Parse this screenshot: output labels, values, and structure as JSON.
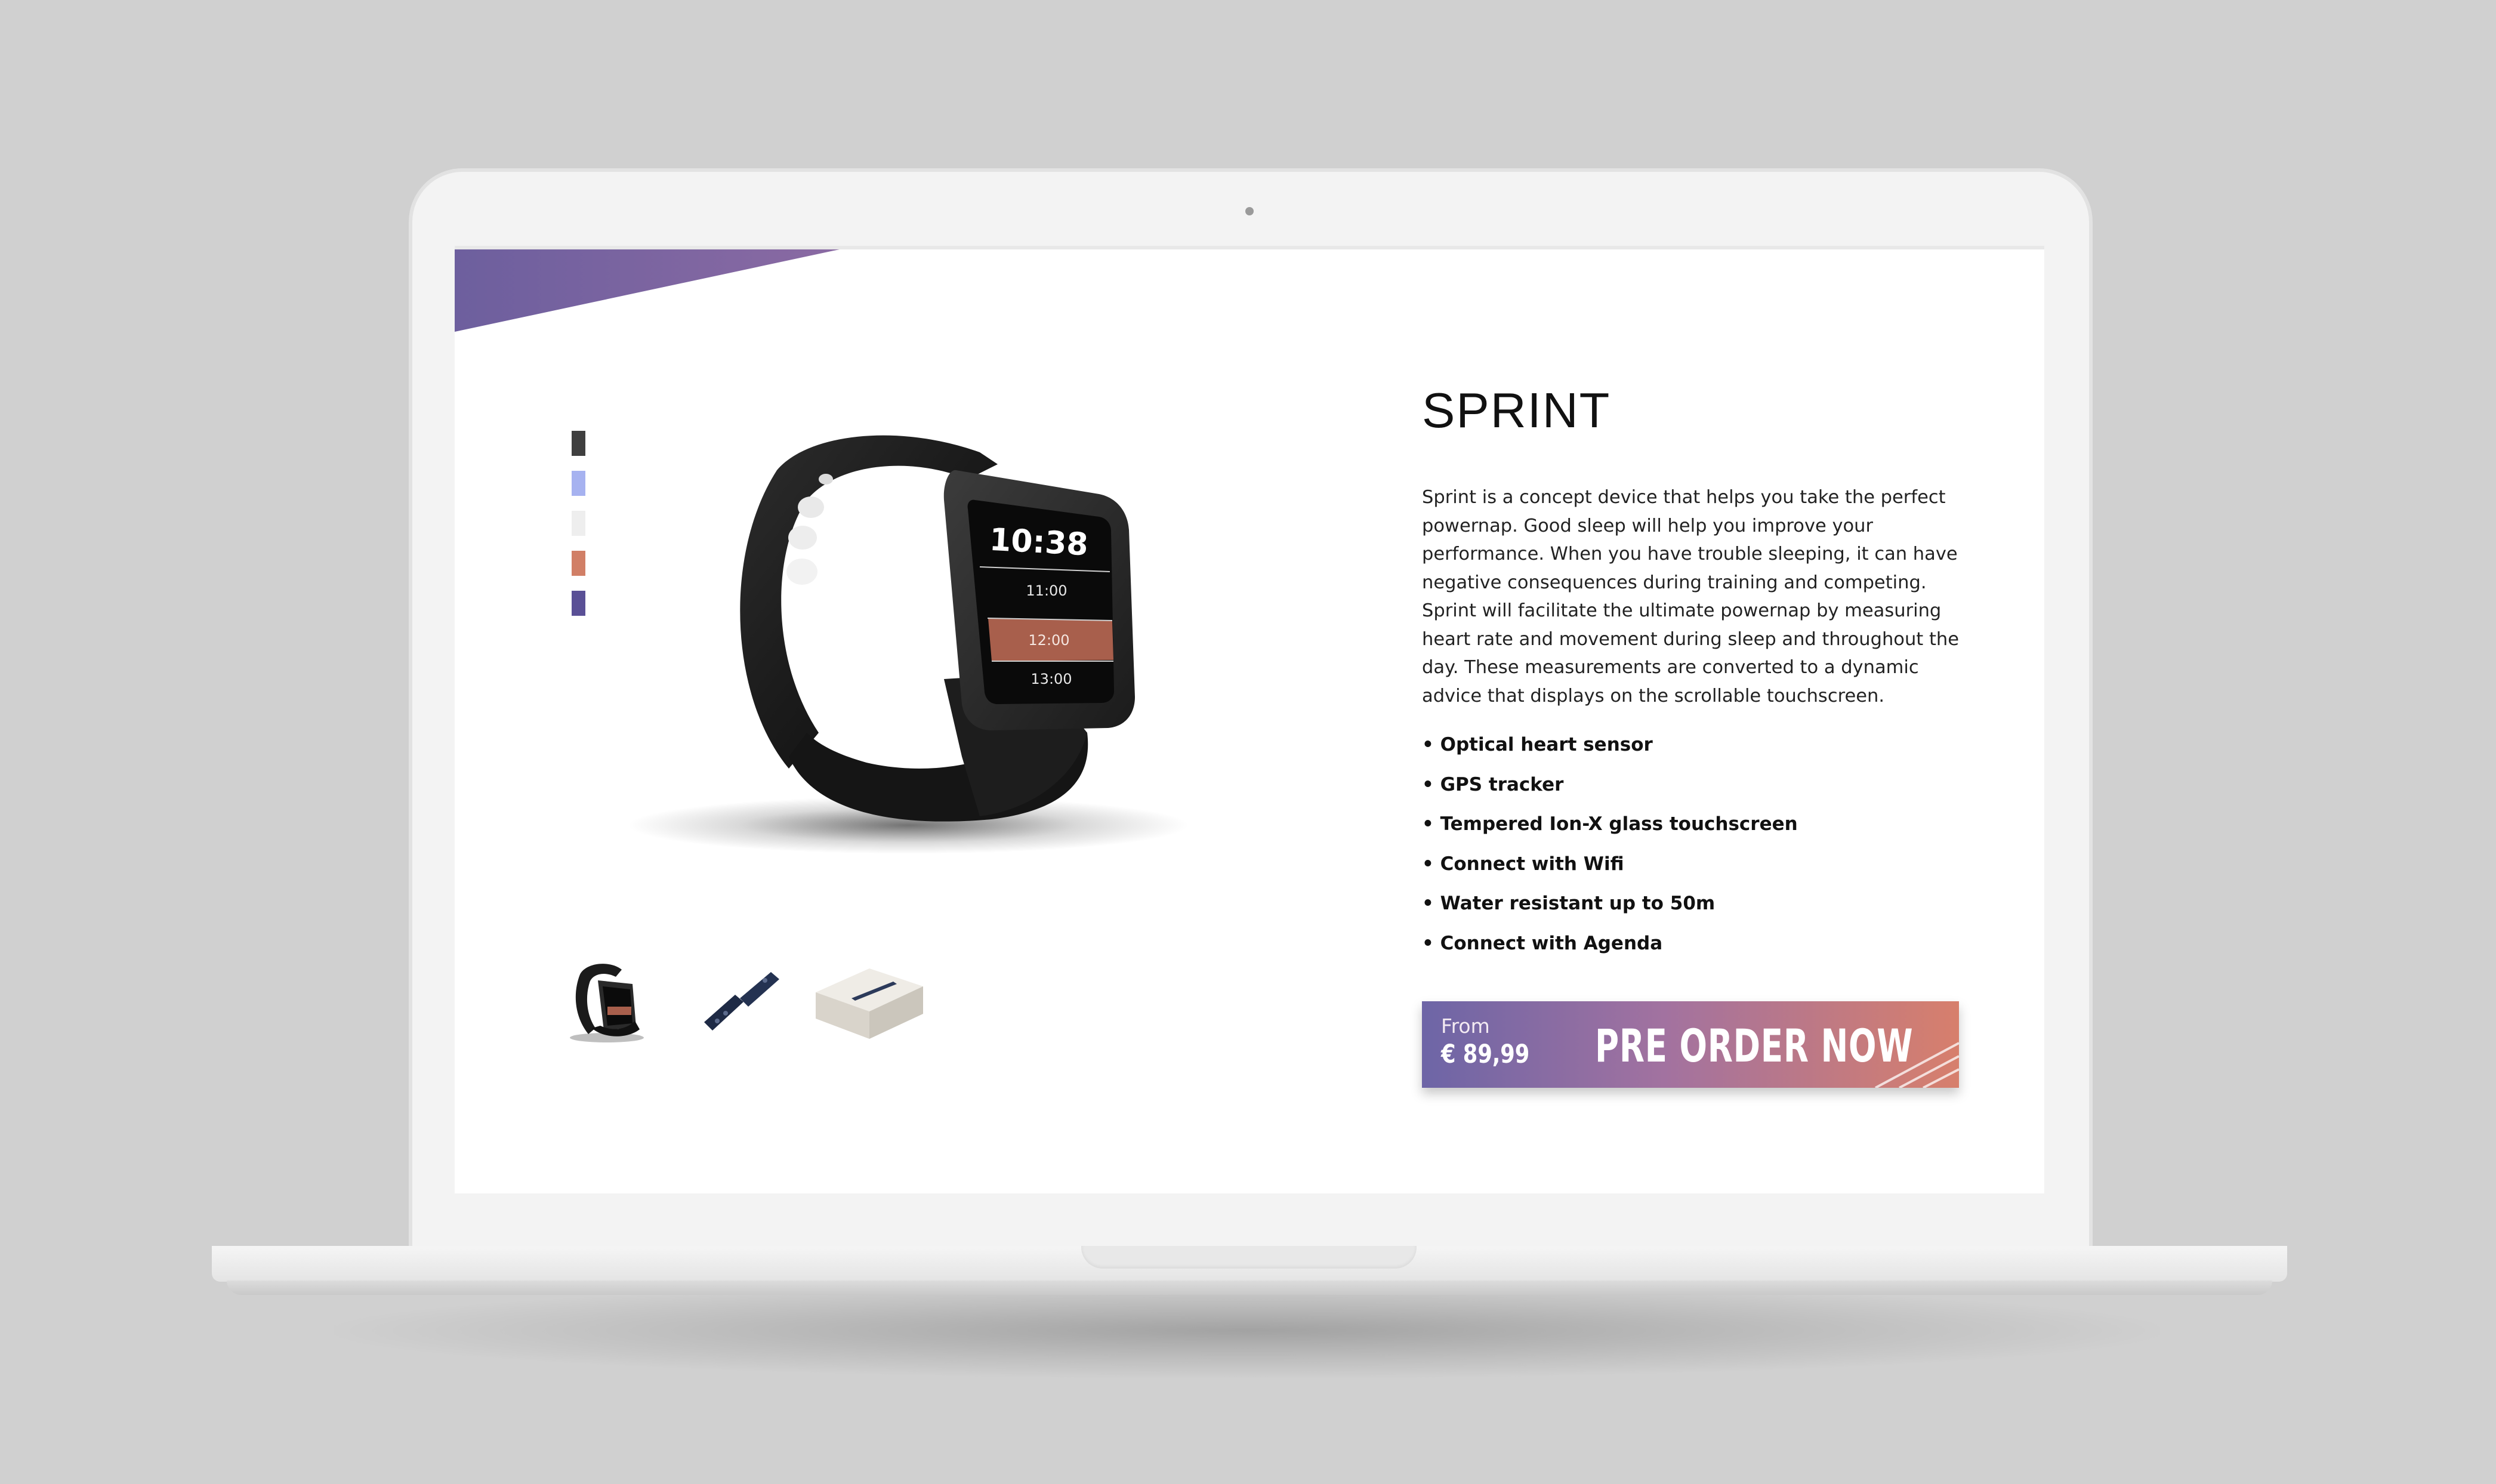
{
  "product": {
    "title": "SPRINT",
    "description": "Sprint is a concept device that helps you take the perfect powernap. Good sleep will help you improve your performance. When you have trouble sleeping, it can have negative consequences during training and competing. Sprint will facilitate the ultimate powernap by measuring heart rate and movement during sleep and throughout the day. These measurements are converted to a dynamic advice that displays on the scrollable touchscreen.",
    "features": [
      "• Optical heart sensor",
      "• GPS tracker",
      "• Tempered Ion-X glass touchscreen",
      "• Connect with Wifi",
      "• Water resistant up to 50m",
      "• Connect with Agenda"
    ],
    "swatches": [
      "#3f3f3f",
      "#a6b2f0",
      "#eeeeee",
      "#d17f66",
      "#5a5096"
    ],
    "thumbnails": [
      "watch-black",
      "watch-strap",
      "watch-box"
    ]
  },
  "watch_screen": {
    "time": "10:38",
    "rows": [
      "11:00",
      "12:00",
      "13:00"
    ]
  },
  "cta": {
    "from_label": "From",
    "price": "€ 89,99",
    "label": "PRE ORDER NOW"
  },
  "colors": {
    "accent_purple": "#6d65a6",
    "accent_coral": "#d77f6c"
  }
}
